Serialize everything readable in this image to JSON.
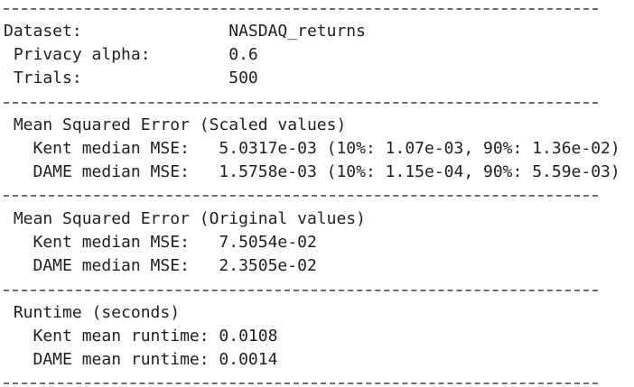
{
  "colors": {
    "background": "#ffffff",
    "text": "#1f1f1f",
    "separator": "#6e6e6e"
  },
  "lines": [
    {
      "type": "separator"
    },
    {
      "type": "text",
      "text": "Dataset:               NASDAQ_returns"
    },
    {
      "type": "text",
      "text": " Privacy alpha:        0.6"
    },
    {
      "type": "text",
      "text": " Trials:               500"
    },
    {
      "type": "separator"
    },
    {
      "type": "text",
      "text": " Mean Squared Error (Scaled values)"
    },
    {
      "type": "text",
      "text": "   Kent median MSE:   5.0317e-03 (10%: 1.07e-03, 90%: 1.36e-02)"
    },
    {
      "type": "text",
      "text": "   DAME median MSE:   1.5758e-03 (10%: 1.15e-04, 90%: 5.59e-03)"
    },
    {
      "type": "separator"
    },
    {
      "type": "text",
      "text": " Mean Squared Error (Original values)"
    },
    {
      "type": "text",
      "text": "   Kent median MSE:   7.5054e-02"
    },
    {
      "type": "text",
      "text": "   DAME median MSE:   2.3505e-02"
    },
    {
      "type": "separator"
    },
    {
      "type": "text",
      "text": " Runtime (seconds)"
    },
    {
      "type": "text",
      "text": "   Kent mean runtime: 0.0108"
    },
    {
      "type": "text",
      "text": "   DAME mean runtime: 0.0014"
    },
    {
      "type": "separator"
    }
  ]
}
